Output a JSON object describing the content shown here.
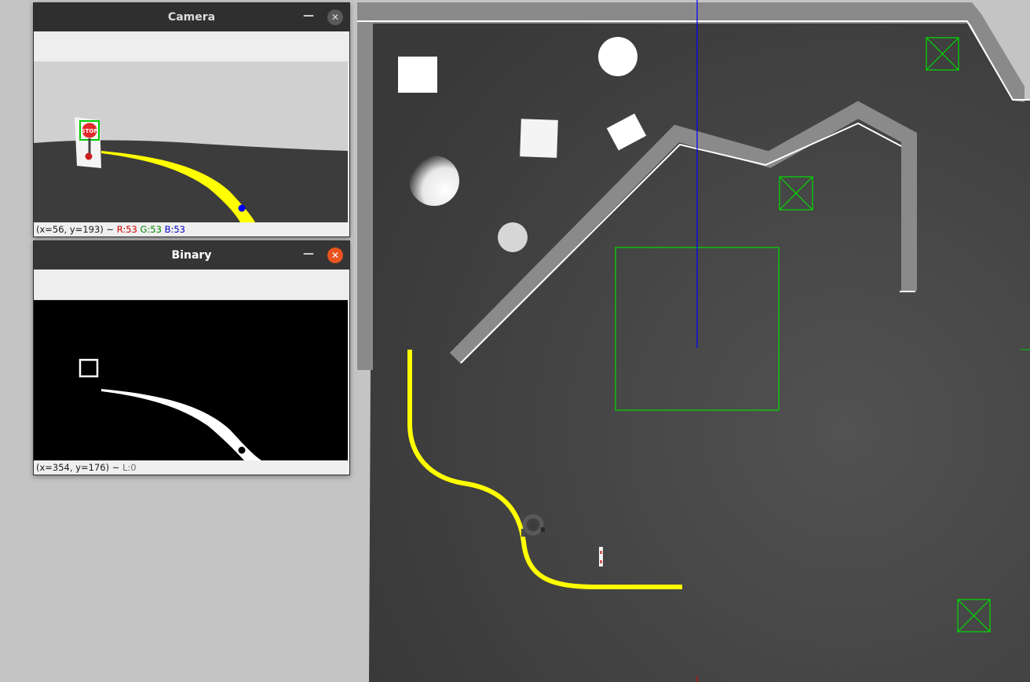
{
  "camera_window": {
    "title": "Camera",
    "stop_sign_text": "STOP",
    "status": {
      "coords": "(x=56, y=193) ~",
      "r_label": "R:53",
      "g_label": "G:53",
      "b_label": "B:53"
    }
  },
  "binary_window": {
    "title": "Binary",
    "status": {
      "coords": "(x=354, y=176) ~",
      "l_label": "L:0"
    }
  },
  "titlebar_icons": {
    "minimize": "minimize-icon",
    "close": "close-icon"
  },
  "colors": {
    "line_yellow": "#ffff00",
    "zone_green": "#00dd00",
    "axis_blue": "#0000ff",
    "wall_gray": "#8a8a8a",
    "floor_dark": "#3f3f3f",
    "close_orange": "#e95420"
  }
}
